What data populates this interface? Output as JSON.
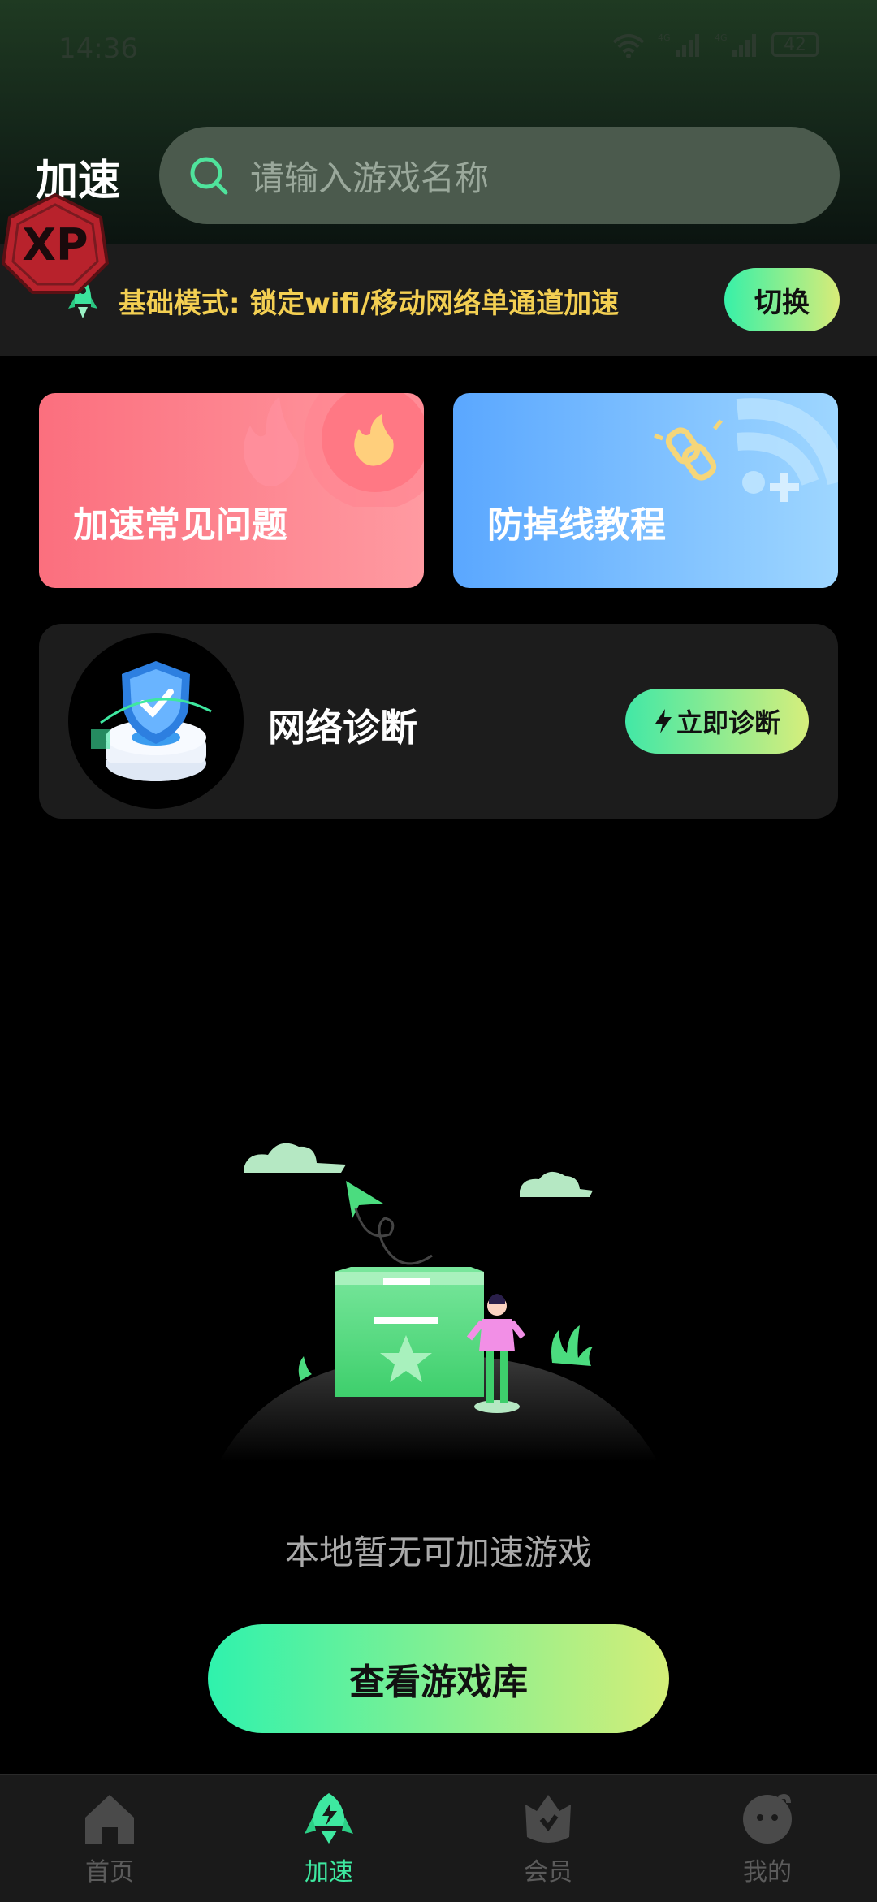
{
  "status_bar": {
    "time": "14:36",
    "battery": "42",
    "net1": "4G",
    "net2": "4G"
  },
  "header": {
    "title": "加速",
    "search_placeholder": "请输入游戏名称"
  },
  "badge": {
    "text": "XP"
  },
  "mode": {
    "text": "基础模式: 锁定wifi/移动网络单通道加速",
    "switch_label": "切换"
  },
  "cards": [
    {
      "label": "加速常见问题"
    },
    {
      "label": "防掉线教程"
    }
  ],
  "diagnostics": {
    "title": "网络诊断",
    "button_label": "立即诊断"
  },
  "empty_state": {
    "message": "本地暂无可加速游戏",
    "button_label": "查看游戏库"
  },
  "nav": [
    {
      "label": "首页",
      "icon": "home-icon",
      "active": false
    },
    {
      "label": "加速",
      "icon": "rocket-icon",
      "active": true
    },
    {
      "label": "会员",
      "icon": "member-icon",
      "active": false
    },
    {
      "label": "我的",
      "icon": "profile-icon",
      "active": false
    }
  ],
  "colors": {
    "accent": "#3ee8a0",
    "mode_text": "#f3cf52"
  }
}
